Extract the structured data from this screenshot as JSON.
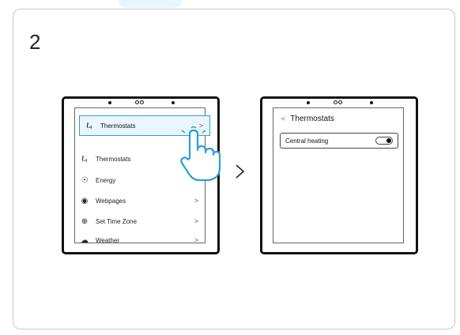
{
  "step": {
    "number": "2"
  },
  "left_device": {
    "highlighted_item": {
      "icon": "thermostat-icon",
      "label": "Thermostats",
      "chevron": ">"
    },
    "menu_items": [
      {
        "icon": "thermostat-icon",
        "label": "Thermostats",
        "chevron": ""
      },
      {
        "icon": "energy-icon",
        "label": "Energy",
        "chevron": ""
      },
      {
        "icon": "webpages-icon",
        "label": "Webpages",
        "chevron": ">"
      },
      {
        "icon": "globe-icon",
        "label": "Set Time Zone",
        "chevron": ">"
      },
      {
        "icon": "weather-icon",
        "label": "Weather",
        "chevron": ">"
      }
    ]
  },
  "right_device": {
    "back_chevron": "<",
    "title": "Thermostats",
    "setting": {
      "label": "Central heating",
      "toggle_state": "on"
    }
  },
  "next_arrow": ">"
}
